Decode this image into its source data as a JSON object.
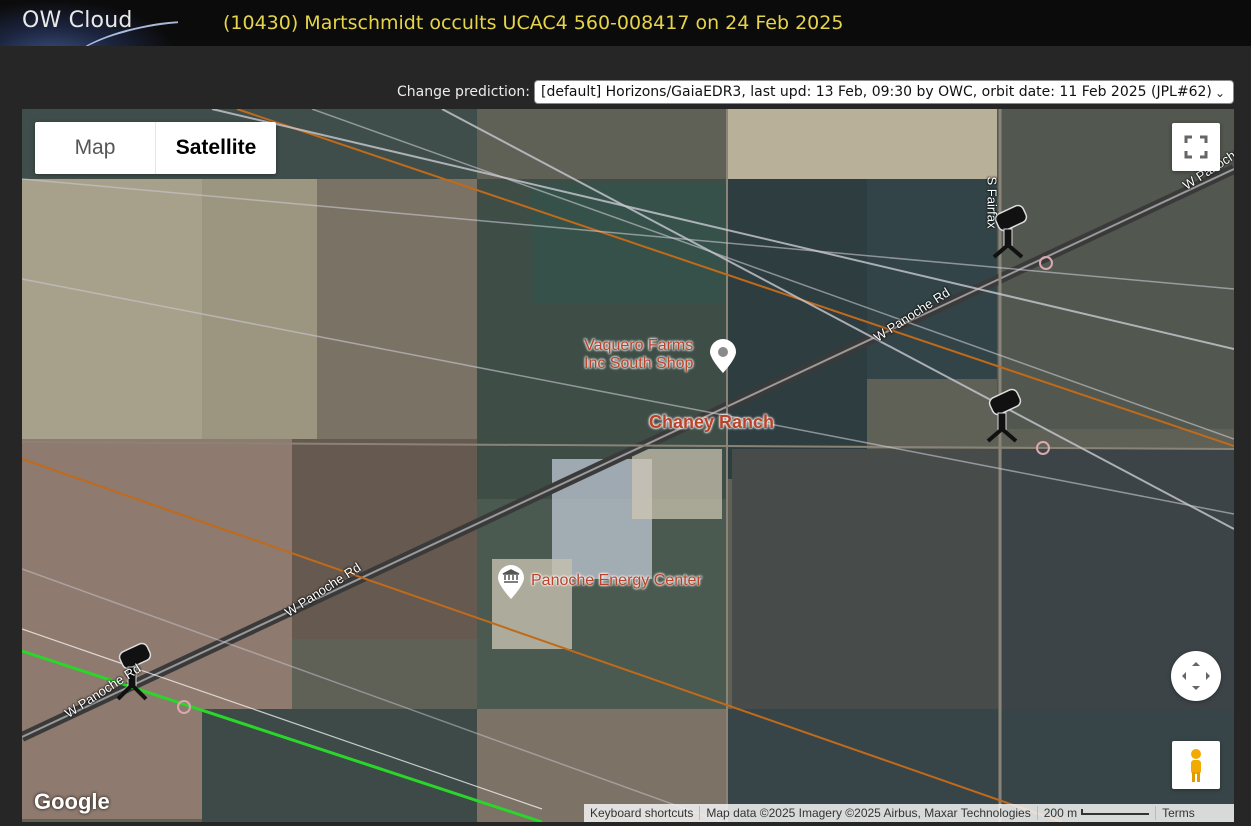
{
  "header": {
    "app_title": "OW Cloud",
    "event_title": "(10430) Martschmidt occults UCAC4 560-008417 on 24 Feb 2025"
  },
  "prediction": {
    "label": "Change prediction:",
    "selected": "[default] Horizons/GaiaEDR3, last upd: 13 Feb, 09:30 by OWC, orbit date: 11 Feb 2025 (JPL#62)"
  },
  "map": {
    "type_buttons": {
      "map": "Map",
      "satellite": "Satellite"
    },
    "active_type": "Satellite",
    "labels": {
      "poi_shop_line1": "Vaquero Farms",
      "poi_shop_line2": "Inc South Shop",
      "ranch": "Chaney Ranch",
      "energy_center": "Panoche Energy Center"
    },
    "roads": {
      "r1": "W Panoche Rd",
      "r2": "W Panoche Rd",
      "r3": "W Panoche Rd",
      "r4": "S Fairfax",
      "r5": "W Panoche"
    },
    "google_logo": "Google",
    "attribution": {
      "shortcuts": "Keyboard shortcuts",
      "data": "Map data ©2025 Imagery ©2025 Airbus, Maxar Technologies",
      "scale": "200 m",
      "terms": "Terms"
    },
    "colors": {
      "path_orange": "#c06a1a",
      "path_green": "#2bd62b",
      "chord_gray": "#c9c9d2",
      "station_marker": "#d9a8b0"
    },
    "icons": [
      "telescope-icon",
      "fullscreen-icon",
      "camera-control-icon",
      "pegman-icon",
      "map-pin-icon",
      "landmark-icon"
    ]
  }
}
